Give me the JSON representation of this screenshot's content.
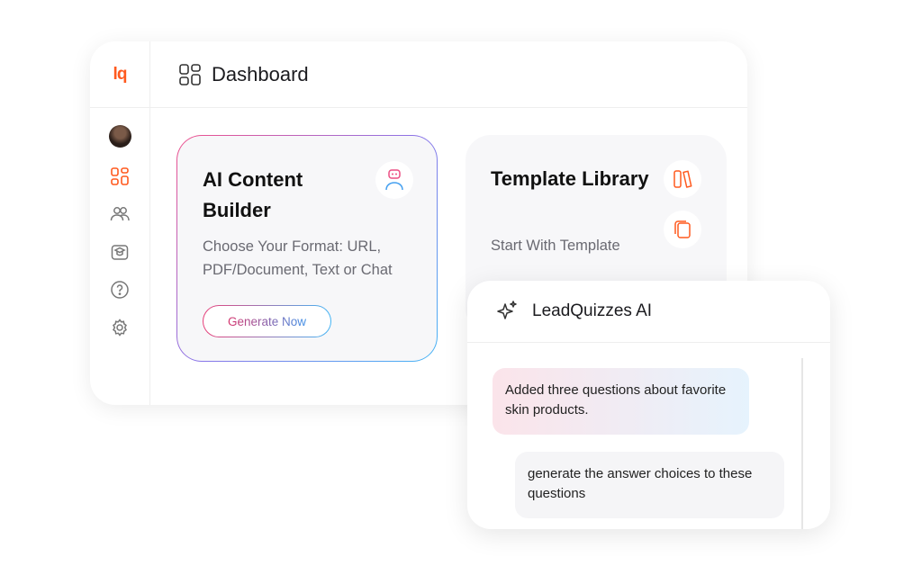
{
  "brand": {
    "logo_text": "lq",
    "accent_color": "#ff5a1f"
  },
  "header": {
    "title": "Dashboard",
    "icon": "dashboard-grid-icon"
  },
  "sidebar": {
    "items": [
      {
        "name": "avatar"
      },
      {
        "name": "dashboard-grid-icon",
        "active": true
      },
      {
        "name": "users-icon"
      },
      {
        "name": "graduation-cap-icon"
      },
      {
        "name": "help-icon"
      },
      {
        "name": "settings-gear-icon"
      }
    ]
  },
  "cards": {
    "ai": {
      "title": "AI Content Builder",
      "description": "Choose Your Format: URL, PDF/Document, Text or Chat",
      "button_label": "Generate Now",
      "icon": "robot-icon"
    },
    "template": {
      "title": "Template Library",
      "description": "Start With Template",
      "icons": [
        "books-icon",
        "copy-pages-icon"
      ]
    }
  },
  "chat": {
    "title": "LeadQuizzes AI",
    "icon": "sparkle-icon",
    "messages": [
      {
        "role": "ai",
        "text": "Added three questions about favorite skin products."
      },
      {
        "role": "user",
        "text": "generate the answer choices to these questions"
      }
    ]
  }
}
